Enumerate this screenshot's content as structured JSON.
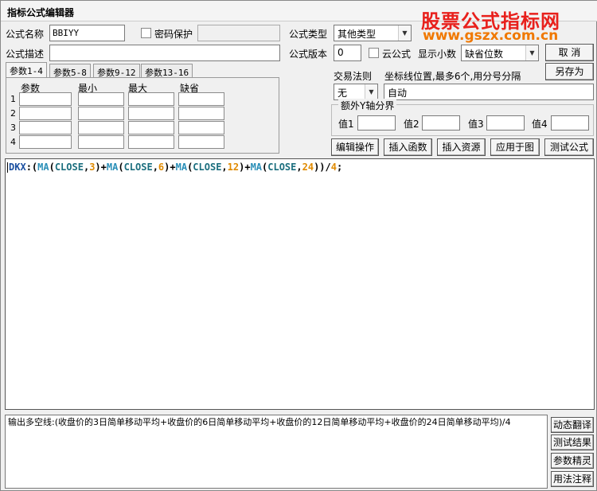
{
  "window": {
    "title": "指标公式编辑器"
  },
  "watermark": {
    "line1": "股票公式指标网",
    "line2": "www.gszx.com.cn"
  },
  "form": {
    "name_label": "公式名称",
    "name_value": "BBIYY",
    "password_label": "密码保护",
    "password_value": "",
    "type_label": "公式类型",
    "type_value": "其他类型",
    "desc_label": "公式描述",
    "desc_value": "",
    "version_label": "公式版本",
    "version_value": "0",
    "cloud_label": "云公式",
    "decimals_label": "显示小数",
    "decimals_value": "缺省位数"
  },
  "buttons": {
    "cancel": "取 消",
    "save_as": "另存为",
    "edit_ops": "编辑操作",
    "insert_fn": "插入函数",
    "insert_res": "插入资源",
    "apply_chart": "应用于图",
    "test_formula": "测试公式"
  },
  "tabs": [
    "参数1-4",
    "参数5-8",
    "参数9-12",
    "参数13-16"
  ],
  "params": {
    "headers": [
      "参数",
      "最小",
      "最大",
      "缺省"
    ],
    "rows": [
      "1",
      "2",
      "3",
      "4"
    ]
  },
  "trade": {
    "label": "交易法则",
    "value": "无",
    "coord_label": "坐标线位置,最多6个,用分号分隔",
    "coord_value": "自动"
  },
  "yaxis": {
    "label": "额外Y轴分界",
    "v1": "值1",
    "v2": "值2",
    "v3": "值3",
    "v4": "值4"
  },
  "code": {
    "tokens": [
      {
        "t": "DKX",
        "c": "c-var"
      },
      {
        "t": ":(",
        "c": "c-op"
      },
      {
        "t": "MA",
        "c": "c-fn"
      },
      {
        "t": "(",
        "c": "c-op"
      },
      {
        "t": "CLOSE",
        "c": "c-kw"
      },
      {
        "t": ",",
        "c": "c-op"
      },
      {
        "t": "3",
        "c": "c-num"
      },
      {
        "t": ")+",
        "c": "c-op"
      },
      {
        "t": "MA",
        "c": "c-fn"
      },
      {
        "t": "(",
        "c": "c-op"
      },
      {
        "t": "CLOSE",
        "c": "c-kw"
      },
      {
        "t": ",",
        "c": "c-op"
      },
      {
        "t": "6",
        "c": "c-num"
      },
      {
        "t": ")+",
        "c": "c-op"
      },
      {
        "t": "MA",
        "c": "c-fn"
      },
      {
        "t": "(",
        "c": "c-op"
      },
      {
        "t": "CLOSE",
        "c": "c-kw"
      },
      {
        "t": ",",
        "c": "c-op"
      },
      {
        "t": "12",
        "c": "c-num"
      },
      {
        "t": ")+",
        "c": "c-op"
      },
      {
        "t": "MA",
        "c": "c-fn"
      },
      {
        "t": "(",
        "c": "c-op"
      },
      {
        "t": "CLOSE",
        "c": "c-kw"
      },
      {
        "t": ",",
        "c": "c-op"
      },
      {
        "t": "24",
        "c": "c-num"
      },
      {
        "t": "))/",
        "c": "c-op"
      },
      {
        "t": "4",
        "c": "c-num"
      },
      {
        "t": ";",
        "c": "c-op"
      }
    ]
  },
  "output": {
    "text": "输出多空线:(收盘价的3日简单移动平均+收盘价的6日简单移动平均+收盘价的12日简单移动平均+收盘价的24日简单移动平均)/4"
  },
  "side_buttons": [
    "动态翻译",
    "测试结果",
    "参数精灵",
    "用法注释"
  ]
}
